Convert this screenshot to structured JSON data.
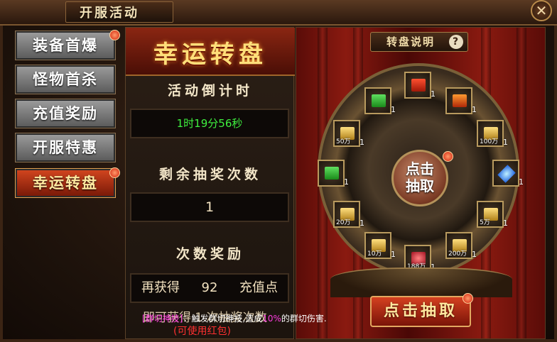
{
  "window": {
    "title": "开服活动",
    "close_glyph": "✕"
  },
  "sidebar": {
    "tabs": [
      {
        "label": "装备首爆",
        "badge": true,
        "active": false
      },
      {
        "label": "怪物首杀",
        "badge": false,
        "active": false
      },
      {
        "label": "充值奖励",
        "badge": false,
        "active": false
      },
      {
        "label": "开服特惠",
        "badge": false,
        "active": false
      },
      {
        "label": "幸运转盘",
        "badge": true,
        "active": true
      }
    ]
  },
  "panel": {
    "banner_title": "幸运转盘",
    "countdown_label": "活动倒计时",
    "countdown_value": "1时19分56秒",
    "remaining_label": "剩余抽奖次数",
    "remaining_value": "1",
    "reward_label": "次数奖励",
    "reward_prefix": "再获得",
    "reward_amount": "92",
    "reward_suffix": "充值点",
    "reward_note": "即可获得 1 次抽奖次数"
  },
  "tooltip": {
    "tag": "[群切神技]",
    "text_a": "：触发群切神技,造成",
    "percent": "10%",
    "text_b": "的群切伤害.",
    "note": "(可使用红包)"
  },
  "wheel": {
    "help_label": "转盘说明",
    "help_icon": "?",
    "center_label_1": "点击",
    "center_label_2": "抽取",
    "draw_button": "点击抽取",
    "slots": [
      {
        "id": "s1",
        "icon": "red-chest-icon",
        "amount": "",
        "count": "1"
      },
      {
        "id": "s2",
        "icon": "fire-book-icon",
        "amount": "",
        "count": "1"
      },
      {
        "id": "s3",
        "icon": "gold-sack-icon",
        "amount": "100万",
        "count": "1"
      },
      {
        "id": "s4",
        "icon": "blue-gem-icon",
        "amount": "",
        "count": "1"
      },
      {
        "id": "s5",
        "icon": "gold-ingot-icon",
        "amount": "5万",
        "count": "1"
      },
      {
        "id": "s6",
        "icon": "gold-ingot-icon",
        "amount": "200万",
        "count": "1"
      },
      {
        "id": "s7",
        "icon": "red-crystal-icon",
        "amount": "188万",
        "count": "1"
      },
      {
        "id": "s8",
        "icon": "gold-ingot-icon",
        "amount": "10万",
        "count": "1"
      },
      {
        "id": "s9",
        "icon": "gold-ingot-icon",
        "amount": "20万",
        "count": "1"
      },
      {
        "id": "s10",
        "icon": "green-scroll-icon",
        "amount": "",
        "count": "1"
      },
      {
        "id": "s11",
        "icon": "gold-sack-icon",
        "amount": "50万",
        "count": "1"
      },
      {
        "id": "s12",
        "icon": "green-gift-icon",
        "amount": "",
        "count": "1"
      }
    ]
  },
  "colors": {
    "accent_red": "#d0441e",
    "countdown_green": "#3ff03f",
    "gold_text": "#ffdf7a",
    "highlight_magenta": "#ff3de0",
    "note_red": "#ff3030"
  }
}
